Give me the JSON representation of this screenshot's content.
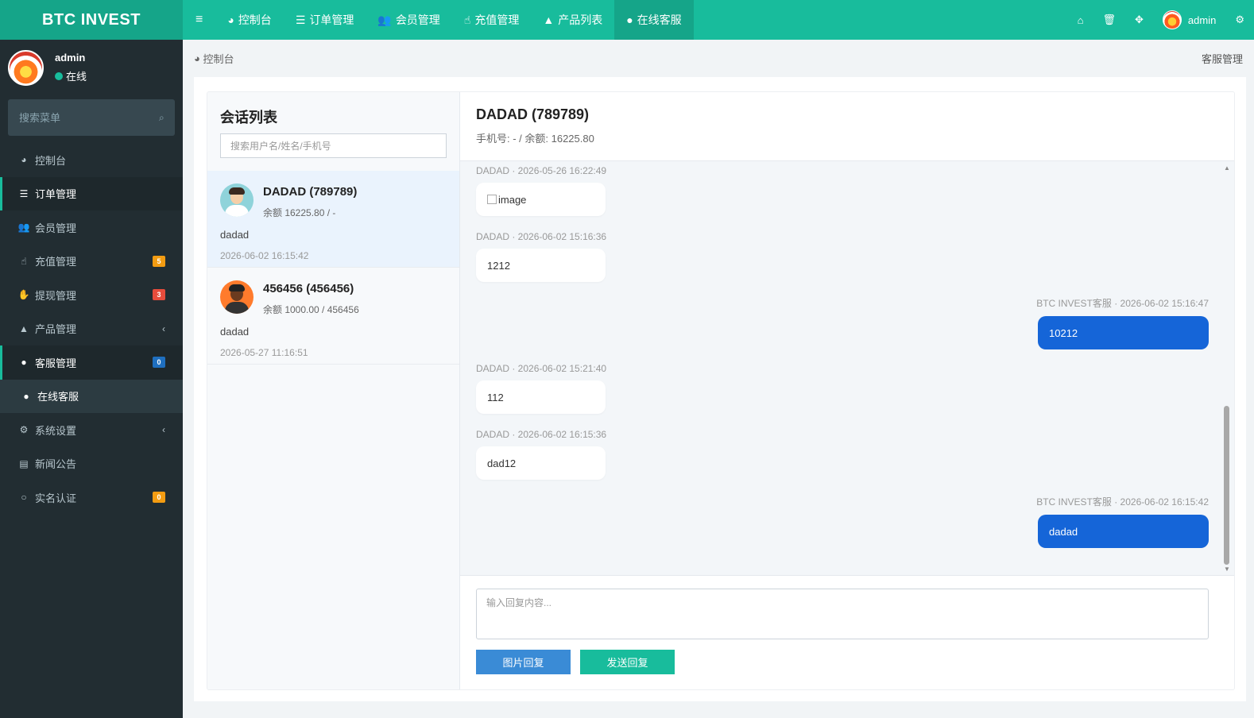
{
  "header": {
    "logo": "BTC INVEST",
    "nav": [
      {
        "icon": "dashboard-icon",
        "glyph": "◕",
        "label": "控制台"
      },
      {
        "icon": "list-icon",
        "glyph": "☰",
        "label": "订单管理"
      },
      {
        "icon": "users-icon",
        "glyph": "👥",
        "label": "会员管理"
      },
      {
        "icon": "hand-icon",
        "glyph": "☝",
        "label": "充值管理"
      },
      {
        "icon": "bag-icon",
        "glyph": "▲",
        "label": "产品列表"
      },
      {
        "icon": "chat-icon",
        "glyph": "●",
        "label": "在线客服"
      }
    ],
    "right": {
      "username": "admin"
    }
  },
  "sidebar": {
    "user": {
      "name": "admin",
      "status": "在线"
    },
    "search_placeholder": "搜索菜单",
    "items": [
      {
        "label": "控制台",
        "glyph": "◕",
        "icon": "dashboard-icon"
      },
      {
        "label": "订单管理",
        "glyph": "☰",
        "icon": "list-icon"
      },
      {
        "label": "会员管理",
        "glyph": "👥",
        "icon": "users-icon"
      },
      {
        "label": "充值管理",
        "glyph": "☝",
        "icon": "hand-icon",
        "badge": "5",
        "badge_color": "#f39c12"
      },
      {
        "label": "提现管理",
        "glyph": "✋",
        "icon": "withdraw-icon",
        "badge": "3",
        "badge_color": "#e74c3c"
      },
      {
        "label": "产品管理",
        "glyph": "▲",
        "icon": "bag-icon"
      },
      {
        "label": "客服管理",
        "glyph": "●",
        "icon": "chat-icon",
        "badge": "0",
        "badge_color": "#1f6fbf"
      },
      {
        "label": "在线客服",
        "glyph": "●",
        "icon": "chat-icon"
      },
      {
        "label": "系统设置",
        "glyph": "⚙",
        "icon": "cogs-icon"
      },
      {
        "label": "新闻公告",
        "glyph": "▤",
        "icon": "newspaper-icon"
      },
      {
        "label": "实名认证",
        "glyph": "○",
        "icon": "circle-icon",
        "badge": "0",
        "badge_color": "#f39c12"
      }
    ]
  },
  "breadcrumb": {
    "current": "控制台",
    "right": "客服管理"
  },
  "conversations": {
    "title": "会话列表",
    "search_placeholder": "搜索用户名/姓名/手机号",
    "items": [
      {
        "name": "DADAD (789789)",
        "meta": "余额 16225.80 / -",
        "last": "dadad",
        "time": "2026-06-02 16:15:42"
      },
      {
        "name": "456456 (456456)",
        "meta": "余额 1000.00 / 456456",
        "last": "dadad",
        "time": "2026-05-27 11:16:51"
      }
    ]
  },
  "chat": {
    "title": "DADAD (789789)",
    "subtitle": "手机号: - / 余额: 16225.80",
    "messages": [
      {
        "meta": "DADAD · 2026-05-26 16:22:49",
        "text": "image"
      },
      {
        "meta": "DADAD · 2026-06-02 15:16:36",
        "text": "1212"
      },
      {
        "meta": "BTC INVEST客服 · 2026-06-02 15:16:47",
        "text": "10212"
      },
      {
        "meta": "DADAD · 2026-06-02 15:21:40",
        "text": "112"
      },
      {
        "meta": "DADAD · 2026-06-02 16:15:36",
        "text": "dad12"
      },
      {
        "meta": "BTC INVEST客服 · 2026-06-02 16:15:42",
        "text": "dadad"
      }
    ],
    "reply_placeholder": "输入回复内容...",
    "image_button": "图片回复",
    "send_button": "发送回复"
  }
}
